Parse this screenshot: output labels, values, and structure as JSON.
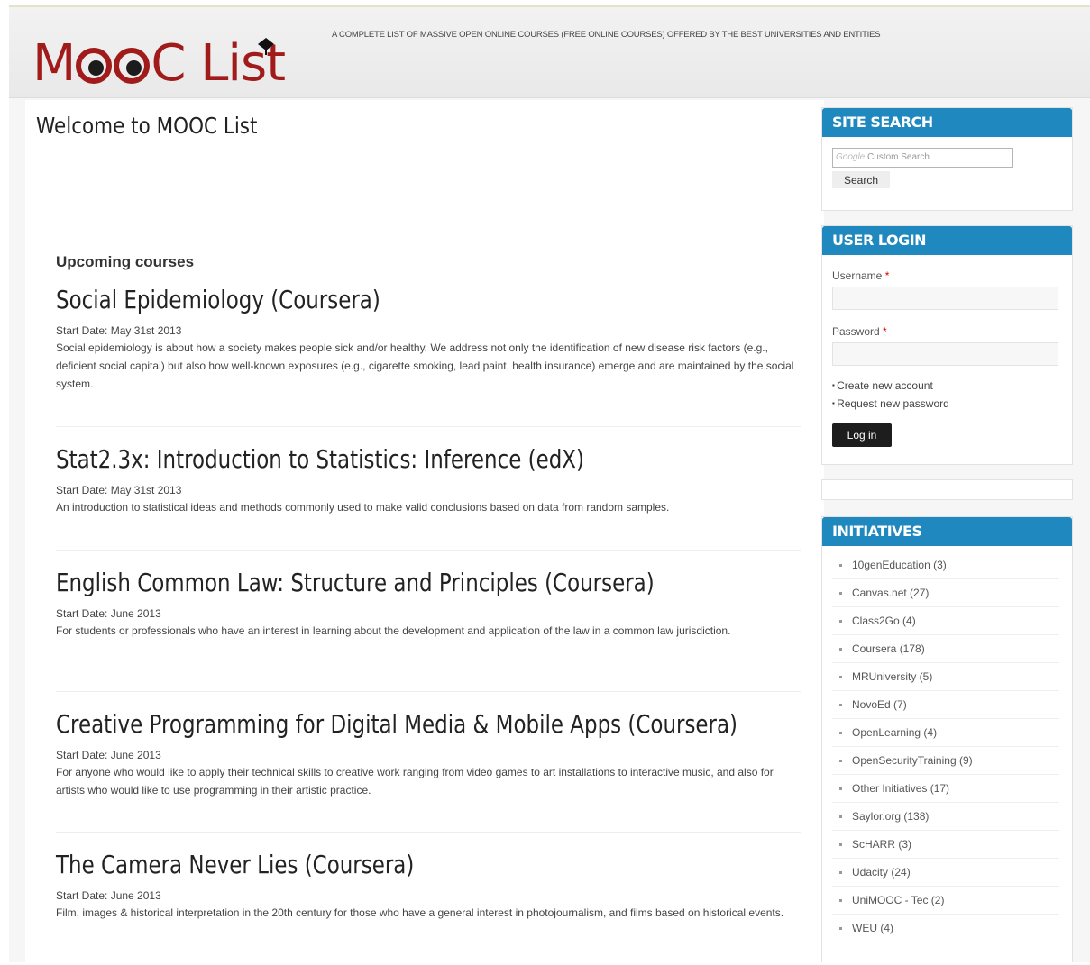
{
  "header": {
    "logo_text_start": "M",
    "logo_text_end": "C List",
    "tagline": "A COMPLETE LIST OF MASSIVE OPEN ONLINE COURSES (FREE ONLINE COURSES) OFFERED BY THE BEST UNIVERSITIES AND ENTITIES"
  },
  "main": {
    "welcome": "Welcome to MOOC List",
    "upcoming_heading": "Upcoming courses",
    "courses": [
      {
        "title": "Social Epidemiology (Coursera)",
        "start_date": "Start Date: May 31st 2013",
        "description": "Social epidemiology is about how a society makes people sick and/or healthy. We address not only the identification of new disease risk factors (e.g., deficient social capital) but also how well-known exposures (e.g., cigarette smoking, lead paint, health insurance) emerge and are maintained by the social system."
      },
      {
        "title": "Stat2.3x: Introduction to Statistics: Inference (edX)",
        "start_date": "Start Date: May 31st 2013",
        "description": "An introduction to statistical ideas and methods commonly used to make valid conclusions based on data from random samples."
      },
      {
        "title": "English Common Law: Structure and Principles (Coursera)",
        "start_date": "Start Date: June 2013",
        "description": "For students or professionals who have an interest in learning about the development and application of the law in a common law jurisdiction."
      },
      {
        "title": "Creative Programming for Digital Media & Mobile Apps (Coursera)",
        "start_date": "Start Date: June 2013",
        "description": "For anyone who would like to apply their technical skills to creative work ranging from video games to art installations to interactive music, and also for artists who would like to use programming in their artistic practice."
      },
      {
        "title": "The Camera Never Lies (Coursera)",
        "start_date": "Start Date: June 2013",
        "description": "Film, images & historical interpretation in the 20th century for those who have a general interest in photojournalism, and films based on historical events."
      }
    ]
  },
  "sidebar": {
    "site_search": {
      "title": "SITE SEARCH",
      "google_label": "Google",
      "placeholder": "Custom Search",
      "button": "Search"
    },
    "user_login": {
      "title": "USER LOGIN",
      "username_label": "Username",
      "password_label": "Password",
      "required_mark": "*",
      "links": [
        "Create new account",
        "Request new password"
      ],
      "button": "Log in"
    },
    "initiatives": {
      "title": "INITIATIVES",
      "items": [
        "10genEducation (3)",
        "Canvas.net (27)",
        "Class2Go (4)",
        "Coursera (178)",
        "MRUniversity (5)",
        "NovoEd (7)",
        "OpenLearning (4)",
        "OpenSecurityTraining (9)",
        "Other Initiatives (17)",
        "Saylor.org (138)",
        "ScHARR (3)",
        "Udacity (24)",
        "UniMOOC - Tec (2)",
        "WEU (4)"
      ]
    }
  },
  "colors": {
    "brand": "#a11b1b",
    "block_header": "#1f88be"
  }
}
